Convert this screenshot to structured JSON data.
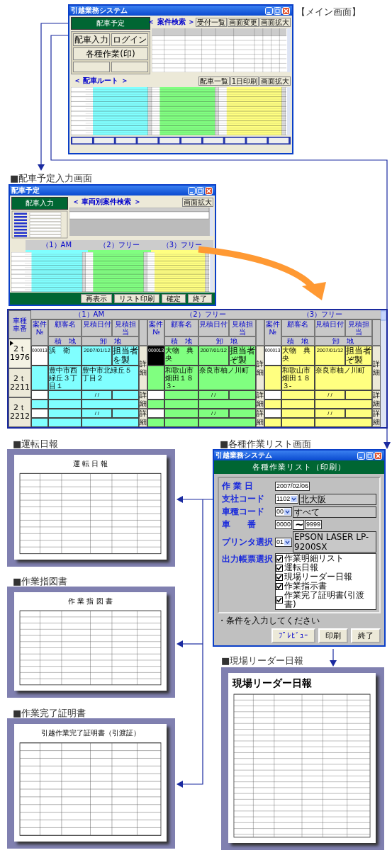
{
  "main_screen": {
    "caption": "【メイン画面】",
    "title": "引越業務システム",
    "side_header": "配車予定",
    "side_buttons": [
      "配車入力",
      "ログイン",
      "各種作業(印)"
    ],
    "search_header": "＜ 案件検索 ＞",
    "search_buttons": [
      "受付一覧",
      "画面変更",
      "画面拡大"
    ],
    "route_header": "＜ 配車ルート ＞",
    "route_buttons": [
      "配車一覧",
      "1日印刷",
      "画面拡大"
    ]
  },
  "dispatch_screen": {
    "caption": "■配車予定入力画面",
    "title": "配車予定",
    "side_header": "配車入力",
    "search_header": "＜ 車両別案件検索 ＞",
    "zoom_button": "画面拡大",
    "bands": [
      {
        "label": "（1）AM",
        "color": "#80ffff"
      },
      {
        "label": "（2）フリー",
        "color": "#80ff80"
      },
      {
        "label": "（3）フリー",
        "color": "#ffff80"
      }
    ],
    "footer_buttons": [
      "再表示",
      "リスト印刷",
      "確定",
      "終了"
    ]
  },
  "detail_grid": {
    "vehicle_header": [
      "車種",
      "車番"
    ],
    "bands": [
      {
        "label": "（1）AM",
        "color": "#80ffff",
        "headers": {
          "case_no": "案件№",
          "customer": "顧客名",
          "est_date": "見積日付",
          "est_staff": "見積担当",
          "load": "積　地",
          "unload": "卸　地"
        }
      },
      {
        "label": "（2）フリー",
        "color": "#80ff80",
        "headers": {
          "case_no": "案件№",
          "customer": "顧客名",
          "est_date": "見積日付",
          "est_staff": "見積担当",
          "load": "積　地",
          "unload": "卸　地"
        }
      },
      {
        "label": "（3）フリー",
        "color": "#ffff80",
        "headers": {
          "case_no": "案件№",
          "customer": "顧客名",
          "est_date": "見積日付",
          "est_staff": "見積担当",
          "load": "積　地",
          "unload": "卸　地"
        }
      }
    ],
    "rows": [
      {
        "selected": true,
        "vehicle_type": "2ｔ",
        "vehicle_no": "1976",
        "slots": [
          {
            "selected": false,
            "case_no": "000013",
            "customer": "浜　衛",
            "est_date": "2007/01/12",
            "est_staff": "担当者を製",
            "load": "豊中市西緑丘３丁目１",
            "unload": "豊中市北緑丘５丁目２",
            "detail_button": "詳細"
          },
          {
            "selected": true,
            "case_no": "000013",
            "customer": "大物　典央",
            "est_date": "2007/01/12",
            "est_staff": "担当者ぞ製",
            "load": "和歌山市畑田１８３-",
            "unload": "奈良市柚ノ川町",
            "detail_button": "詳細"
          },
          {
            "selected": false,
            "case_no": "000013",
            "customer": "大物　典央",
            "est_date": "2007/01/12",
            "est_staff": "担当者ぞ製",
            "load": "和歌山市畑田１８３-",
            "unload": "奈良市柚ノ川町",
            "detail_button": "詳細"
          }
        ]
      },
      {
        "selected": false,
        "vehicle_type": "2ｔ",
        "vehicle_no": "2211",
        "slots": [
          {
            "selected": false,
            "est_date": "/ /",
            "detail_button": "詳細"
          },
          {
            "selected": false,
            "est_date": "/ /",
            "detail_button": "詳細"
          },
          {
            "selected": false,
            "est_date": "/ /",
            "detail_button": "詳細"
          }
        ]
      },
      {
        "selected": false,
        "vehicle_type": "2ｔ",
        "vehicle_no": "2212",
        "slots": [
          {
            "selected": false,
            "est_date": "/ /",
            "detail_button": "詳細"
          },
          {
            "selected": false,
            "est_date": "/ /",
            "detail_button": "詳細"
          },
          {
            "selected": false,
            "est_date": "/ /",
            "detail_button": "詳細"
          }
        ]
      }
    ]
  },
  "print_dialog": {
    "caption": "■各種作業リスト画面",
    "title": "引越業務システム",
    "header": "各種作業リスト（印刷）",
    "fields": [
      {
        "kind": "text",
        "label": "作 業 日",
        "value": "2007/02/06"
      },
      {
        "kind": "select",
        "label": "支社コード",
        "code": "1102",
        "name": "北大阪"
      },
      {
        "kind": "select",
        "label": "車種コード",
        "code": "00",
        "name": "すべて"
      },
      {
        "kind": "range",
        "label": "車　　番",
        "from": "0000",
        "separator": "~",
        "to": "9999"
      },
      {
        "kind": "select",
        "label": "プリンタ選択",
        "code": "01",
        "name": "EPSON LASER LP-9200SX"
      }
    ],
    "output_label": "出力帳票選択",
    "outputs": [
      {
        "label": "作業明細リスト",
        "checked": true
      },
      {
        "label": "運転日報",
        "checked": true
      },
      {
        "label": "現場リーダー日報",
        "checked": true
      },
      {
        "label": "作業指示書",
        "checked": true
      },
      {
        "label": "作業完了証明書(引渡書)",
        "checked": true
      }
    ],
    "note": "・条件を入力してください",
    "buttons": [
      "ﾌﾟﾚﾋﾞｭｰ",
      "印刷",
      "終了"
    ]
  },
  "documents": [
    {
      "caption": "■運転日報",
      "title": "運 転 日 報"
    },
    {
      "caption": "■作業指図書",
      "title": "作 業 指 図 書"
    },
    {
      "caption": "■作業完了証明書",
      "title": "引越作業完了証明書（引渡証）"
    },
    {
      "caption": "■現場リーダー日報",
      "title": "現場リーダー日報"
    }
  ]
}
